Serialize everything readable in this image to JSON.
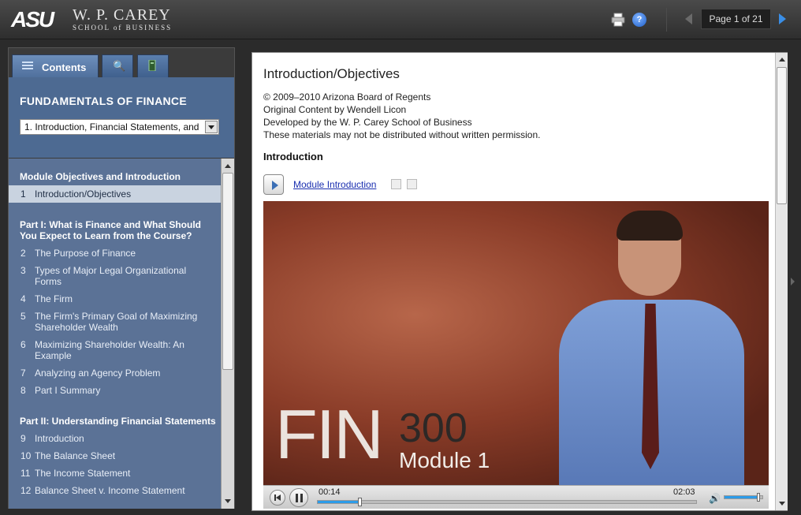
{
  "header": {
    "logo_asu": "ASU",
    "logo_line1": "W. P. CAREY",
    "logo_line2": "SCHOOL of BUSINESS",
    "page_indicator": "Page 1 of 21"
  },
  "sidebar": {
    "tabs": [
      {
        "label": "Contents",
        "icon": "list-icon"
      },
      {
        "label": "",
        "icon": "search-icon"
      },
      {
        "label": "",
        "icon": "bookmark-icon"
      }
    ],
    "course_title": "FUNDAMENTALS OF FINANCE",
    "module_select": "1. Introduction, Financial Statements, and",
    "sections": [
      "Module Objectives and Introduction",
      "Part I: What is Finance and What Should You Expect to Learn from the Course?",
      "Part II: Understanding Financial Statements"
    ],
    "items": [
      {
        "num": "1",
        "label": "Introduction/Objectives"
      },
      {
        "num": "2",
        "label": "The Purpose of Finance"
      },
      {
        "num": "3",
        "label": "Types of Major Legal Organizational Forms"
      },
      {
        "num": "4",
        "label": "The Firm"
      },
      {
        "num": "5",
        "label": "The Firm's Primary Goal of Maximizing Shareholder Wealth"
      },
      {
        "num": "6",
        "label": "Maximizing Shareholder Wealth: An Example"
      },
      {
        "num": "7",
        "label": "Analyzing an Agency Problem"
      },
      {
        "num": "8",
        "label": "Part I Summary"
      },
      {
        "num": "9",
        "label": "Introduction"
      },
      {
        "num": "10",
        "label": "The Balance Sheet"
      },
      {
        "num": "11",
        "label": "The Income Statement"
      },
      {
        "num": "12",
        "label": "Balance Sheet v. Income Statement"
      }
    ]
  },
  "content": {
    "title": "Introduction/Objectives",
    "meta": [
      "© 2009–2010 Arizona Board of Regents",
      "Original Content by Wendell Licon",
      "Developed by the W. P. Carey School of Business",
      "These materials may not be distributed without written permission."
    ],
    "section_heading": "Introduction",
    "media_link": "Module Introduction",
    "video_title_main": "FIN",
    "video_title_num": "300",
    "video_title_module": "Module 1",
    "time_current": "00:14",
    "time_total": "02:03",
    "progress": 0.11,
    "volume": 0.9
  }
}
